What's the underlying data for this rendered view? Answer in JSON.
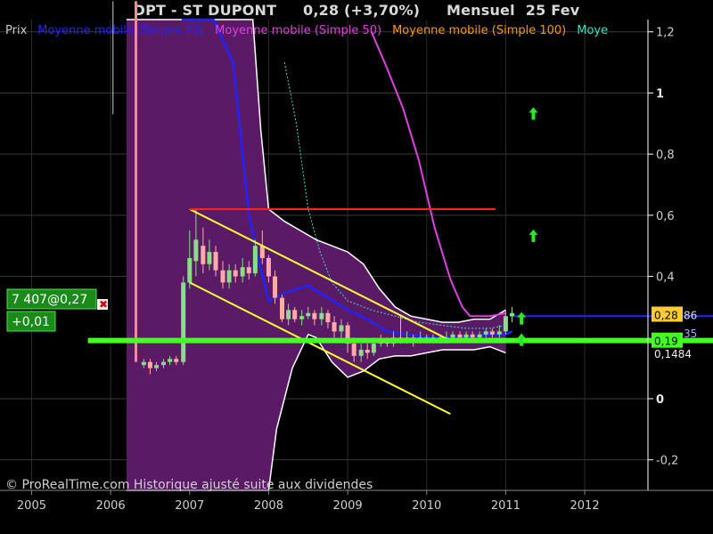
{
  "header": {
    "ticker": "DPT - ST DUPONT",
    "change": "0,28 (+3,70%)",
    "period": "Mensuel",
    "date": "25 Fev"
  },
  "legend": [
    {
      "label": "Prix",
      "color": "#cccccc"
    },
    {
      "label": "Moyenne mobile (Simple 20)",
      "color": "#2222ff"
    },
    {
      "label": "Moyenne mobile (Simple 50)",
      "color": "#e040e0"
    },
    {
      "label": "Moyenne mobile (Simple 100)",
      "color": "#ff9900"
    },
    {
      "label": "Moye",
      "color": "#40e0c0"
    }
  ],
  "info_box": {
    "volume_price": "7 407@0,27",
    "change": "+0,01"
  },
  "price_tags": {
    "current": "0,28",
    "current_suffix": "86",
    "ma": "35",
    "support": "0,19",
    "low": "0,1484"
  },
  "watermark": "© ProRealTime.com Historique ajusté suite aux dividendes",
  "colors": {
    "background": "#000000",
    "band_fill": "#5a1a66",
    "band_edge": "#ffffff",
    "up_candle": "#88dd88",
    "down_candle": "#ffaaaa",
    "sma20": "#2222ff",
    "sma50": "#e040e0",
    "sma_cyan": "#40e0c0",
    "channel": "#ffff33",
    "resistance": "#ff2222",
    "support": "#44ff22",
    "arrows": "#22ee22"
  },
  "chart_data": {
    "type": "line",
    "title": "DPT - ST DUPONT",
    "ylim": [
      -0.3,
      1.24
    ],
    "xlim": [
      2004.6,
      2012.8
    ],
    "y_ticks": [
      {
        "v": 1.2,
        "label": "1,2",
        "bold": false
      },
      {
        "v": 1.0,
        "label": "1",
        "bold": true
      },
      {
        "v": 0.8,
        "label": "0,8",
        "bold": false
      },
      {
        "v": 0.6,
        "label": "0,6",
        "bold": false
      },
      {
        "v": 0.4,
        "label": "0,4",
        "bold": false
      },
      {
        "v": 0.0,
        "label": "0",
        "bold": true
      },
      {
        "v": -0.2,
        "label": "-0,2",
        "bold": false
      }
    ],
    "x_ticks": [
      {
        "v": 2005,
        "label": "2005"
      },
      {
        "v": 2006,
        "label": "2006"
      },
      {
        "v": 2007,
        "label": "2007"
      },
      {
        "v": 2008,
        "label": "2008"
      },
      {
        "v": 2009,
        "label": "2009"
      },
      {
        "v": 2010,
        "label": "2010"
      },
      {
        "v": 2011,
        "label": "2011"
      },
      {
        "v": 2012,
        "label": "2012"
      }
    ],
    "candles": [
      [
        2006.42,
        0.11,
        0.12,
        0.1,
        0.13
      ],
      [
        2006.5,
        0.12,
        0.1,
        0.08,
        0.13
      ],
      [
        2006.58,
        0.1,
        0.11,
        0.09,
        0.12
      ],
      [
        2006.67,
        0.11,
        0.12,
        0.1,
        0.13
      ],
      [
        2006.75,
        0.12,
        0.13,
        0.11,
        0.14
      ],
      [
        2006.83,
        0.13,
        0.12,
        0.11,
        0.14
      ],
      [
        2006.92,
        0.12,
        0.38,
        0.11,
        0.4
      ],
      [
        2007.0,
        0.38,
        0.46,
        0.36,
        0.55
      ],
      [
        2007.08,
        0.45,
        0.52,
        0.4,
        0.62
      ],
      [
        2007.17,
        0.5,
        0.44,
        0.41,
        0.56
      ],
      [
        2007.25,
        0.44,
        0.48,
        0.42,
        0.52
      ],
      [
        2007.33,
        0.48,
        0.42,
        0.4,
        0.5
      ],
      [
        2007.42,
        0.42,
        0.38,
        0.36,
        0.45
      ],
      [
        2007.5,
        0.38,
        0.42,
        0.36,
        0.44
      ],
      [
        2007.58,
        0.42,
        0.4,
        0.38,
        0.44
      ],
      [
        2007.67,
        0.4,
        0.43,
        0.38,
        0.46
      ],
      [
        2007.75,
        0.43,
        0.41,
        0.39,
        0.45
      ],
      [
        2007.83,
        0.41,
        0.5,
        0.4,
        0.52
      ],
      [
        2007.92,
        0.5,
        0.46,
        0.44,
        0.55
      ],
      [
        2008.0,
        0.46,
        0.4,
        0.38,
        0.47
      ],
      [
        2008.08,
        0.4,
        0.33,
        0.31,
        0.42
      ],
      [
        2008.17,
        0.33,
        0.26,
        0.25,
        0.34
      ],
      [
        2008.25,
        0.26,
        0.29,
        0.24,
        0.31
      ],
      [
        2008.33,
        0.29,
        0.26,
        0.25,
        0.3
      ],
      [
        2008.42,
        0.26,
        0.27,
        0.24,
        0.29
      ],
      [
        2008.5,
        0.27,
        0.28,
        0.26,
        0.3
      ],
      [
        2008.58,
        0.28,
        0.26,
        0.24,
        0.29
      ],
      [
        2008.67,
        0.26,
        0.28,
        0.24,
        0.3
      ],
      [
        2008.75,
        0.28,
        0.25,
        0.23,
        0.29
      ],
      [
        2008.83,
        0.25,
        0.22,
        0.2,
        0.27
      ],
      [
        2008.92,
        0.22,
        0.24,
        0.19,
        0.26
      ],
      [
        2009.0,
        0.24,
        0.18,
        0.15,
        0.25
      ],
      [
        2009.08,
        0.18,
        0.14,
        0.12,
        0.2
      ],
      [
        2009.17,
        0.14,
        0.16,
        0.12,
        0.18
      ],
      [
        2009.25,
        0.16,
        0.15,
        0.13,
        0.18
      ],
      [
        2009.33,
        0.15,
        0.18,
        0.14,
        0.2
      ],
      [
        2009.42,
        0.18,
        0.19,
        0.17,
        0.21
      ],
      [
        2009.5,
        0.19,
        0.18,
        0.17,
        0.2
      ],
      [
        2009.58,
        0.18,
        0.2,
        0.17,
        0.22
      ],
      [
        2009.67,
        0.2,
        0.19,
        0.18,
        0.27
      ],
      [
        2009.75,
        0.19,
        0.2,
        0.18,
        0.22
      ],
      [
        2009.83,
        0.2,
        0.19,
        0.17,
        0.21
      ],
      [
        2009.92,
        0.19,
        0.2,
        0.18,
        0.22
      ],
      [
        2010.0,
        0.2,
        0.19,
        0.18,
        0.21
      ],
      [
        2010.08,
        0.19,
        0.2,
        0.18,
        0.21
      ],
      [
        2010.17,
        0.2,
        0.19,
        0.18,
        0.21
      ],
      [
        2010.25,
        0.19,
        0.2,
        0.18,
        0.22
      ],
      [
        2010.33,
        0.2,
        0.21,
        0.19,
        0.22
      ],
      [
        2010.42,
        0.21,
        0.2,
        0.19,
        0.22
      ],
      [
        2010.5,
        0.2,
        0.21,
        0.19,
        0.22
      ],
      [
        2010.58,
        0.21,
        0.2,
        0.19,
        0.22
      ],
      [
        2010.67,
        0.2,
        0.21,
        0.19,
        0.22
      ],
      [
        2010.75,
        0.21,
        0.22,
        0.2,
        0.23
      ],
      [
        2010.83,
        0.22,
        0.21,
        0.2,
        0.23
      ],
      [
        2010.92,
        0.21,
        0.22,
        0.2,
        0.24
      ],
      [
        2011.0,
        0.22,
        0.27,
        0.21,
        0.29
      ],
      [
        2011.08,
        0.27,
        0.28,
        0.25,
        0.3
      ]
    ],
    "band_upper": [
      [
        2006.2,
        1.3
      ],
      [
        2006.6,
        1.3
      ],
      [
        2006.9,
        1.3
      ],
      [
        2007.1,
        1.3
      ],
      [
        2007.5,
        1.3
      ],
      [
        2007.8,
        1.3
      ],
      [
        2007.9,
        0.88
      ],
      [
        2008.0,
        0.62
      ],
      [
        2008.2,
        0.58
      ],
      [
        2008.4,
        0.55
      ],
      [
        2008.6,
        0.52
      ],
      [
        2008.8,
        0.5
      ],
      [
        2009.0,
        0.48
      ],
      [
        2009.2,
        0.44
      ],
      [
        2009.4,
        0.36
      ],
      [
        2009.6,
        0.3
      ],
      [
        2009.8,
        0.27
      ],
      [
        2010.0,
        0.26
      ],
      [
        2010.2,
        0.25
      ],
      [
        2010.4,
        0.25
      ],
      [
        2010.6,
        0.26
      ],
      [
        2010.8,
        0.26
      ],
      [
        2011.0,
        0.29
      ]
    ],
    "band_lower": [
      [
        2011.0,
        0.15
      ],
      [
        2010.8,
        0.17
      ],
      [
        2010.6,
        0.16
      ],
      [
        2010.4,
        0.16
      ],
      [
        2010.2,
        0.16
      ],
      [
        2010.0,
        0.15
      ],
      [
        2009.8,
        0.14
      ],
      [
        2009.6,
        0.14
      ],
      [
        2009.4,
        0.13
      ],
      [
        2009.2,
        0.09
      ],
      [
        2009.0,
        0.07
      ],
      [
        2008.8,
        0.12
      ],
      [
        2008.6,
        0.2
      ],
      [
        2008.5,
        0.21
      ],
      [
        2008.3,
        0.1
      ],
      [
        2008.1,
        -0.1
      ],
      [
        2008.0,
        -0.4
      ],
      [
        2007.8,
        -0.4
      ],
      [
        2007.0,
        -0.4
      ],
      [
        2006.5,
        -0.4
      ],
      [
        2006.2,
        -0.4
      ]
    ],
    "sma20": [
      [
        2006.9,
        1.3
      ],
      [
        2007.3,
        1.3
      ],
      [
        2007.55,
        1.1
      ],
      [
        2007.75,
        0.6
      ],
      [
        2007.85,
        0.48
      ],
      [
        2008.0,
        0.32
      ],
      [
        2008.25,
        0.35
      ],
      [
        2008.5,
        0.37
      ],
      [
        2008.75,
        0.33
      ],
      [
        2009.0,
        0.29
      ],
      [
        2009.25,
        0.26
      ],
      [
        2009.5,
        0.22
      ],
      [
        2009.75,
        0.21
      ],
      [
        2010.0,
        0.2
      ],
      [
        2010.25,
        0.2
      ],
      [
        2010.5,
        0.2
      ],
      [
        2010.75,
        0.21
      ],
      [
        2011.0,
        0.21
      ],
      [
        2011.08,
        0.22
      ]
    ],
    "sma_cyan": [
      [
        2008.2,
        1.1
      ],
      [
        2008.35,
        0.9
      ],
      [
        2008.5,
        0.62
      ],
      [
        2008.65,
        0.48
      ],
      [
        2008.8,
        0.38
      ],
      [
        2009.0,
        0.32
      ],
      [
        2009.3,
        0.29
      ],
      [
        2009.6,
        0.27
      ],
      [
        2009.9,
        0.25
      ],
      [
        2010.2,
        0.24
      ],
      [
        2010.5,
        0.23
      ],
      [
        2010.8,
        0.23
      ],
      [
        2011.0,
        0.24
      ]
    ],
    "sma50": [
      [
        2009.3,
        1.2
      ],
      [
        2009.5,
        1.08
      ],
      [
        2009.7,
        0.95
      ],
      [
        2009.9,
        0.78
      ],
      [
        2010.1,
        0.56
      ],
      [
        2010.3,
        0.39
      ],
      [
        2010.45,
        0.3
      ],
      [
        2010.55,
        0.27
      ],
      [
        2010.8,
        0.27
      ],
      [
        2011.0,
        0.28
      ]
    ],
    "channel": [
      [
        [
          2007.0,
          0.62
        ],
        [
          2010.3,
          0.19
        ]
      ],
      [
        [
          2007.0,
          0.38
        ],
        [
          2010.3,
          -0.05
        ]
      ]
    ],
    "resistance": [
      [
        2007.0,
        0.62
      ],
      [
        2010.87,
        0.62
      ]
    ],
    "support": [
      [
        2005.6,
        0.19
      ],
      [
        2012.8,
        0.19
      ]
    ],
    "price_line": 0.27,
    "arrows": [
      [
        2011.35,
        0.93
      ],
      [
        2011.35,
        0.53
      ],
      [
        2011.2,
        0.26
      ],
      [
        2011.2,
        0.19
      ]
    ]
  }
}
